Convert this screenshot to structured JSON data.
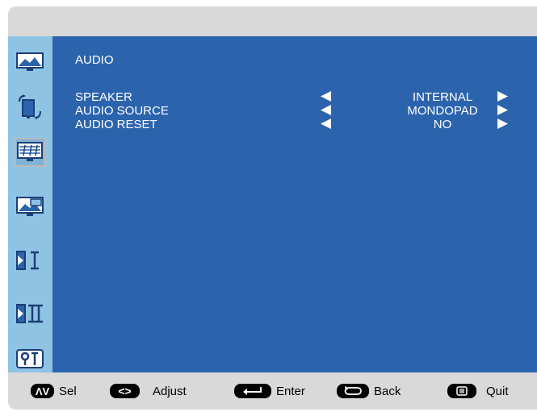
{
  "menu": {
    "title": "AUDIO",
    "rows": [
      {
        "label": "SPEAKER",
        "value": "INTERNAL"
      },
      {
        "label": "AUDIO SOURCE",
        "value": "MONDOPAD"
      },
      {
        "label": "AUDIO RESET",
        "value": "NO"
      }
    ]
  },
  "sidebar": {
    "items": [
      "picture-icon",
      "screen-rotate-icon",
      "audio-icon",
      "pip-icon",
      "input-1-icon",
      "input-2-icon",
      "settings-icon"
    ],
    "selected_index": 2
  },
  "footer": {
    "sel_key": "ΛV",
    "sel_label": "Sel",
    "adjust_key": "<>",
    "adjust_label": "Adjust",
    "enter_label": "Enter",
    "back_label": "Back",
    "quit_label": "Quit"
  },
  "colors": {
    "main_bg": "#2b64ad",
    "sidebar_bg": "#8fc3e4",
    "bar_bg": "#d9d9d9",
    "text": "#ffffff"
  }
}
